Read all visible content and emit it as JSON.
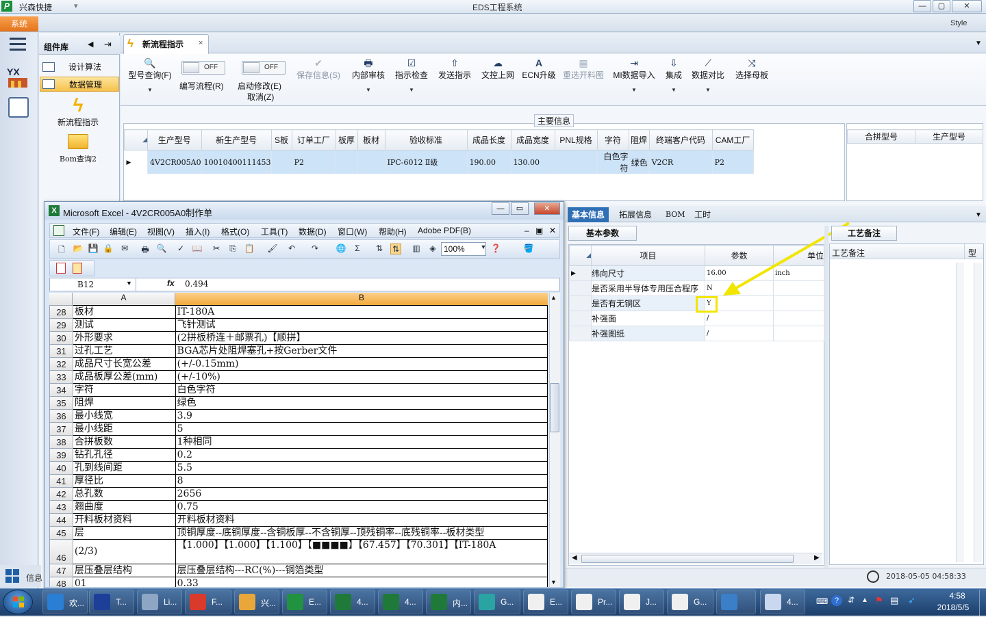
{
  "titlebar": {
    "app_name": "兴森快捷",
    "quick_access": "▾",
    "window_title": "EDS工程系统",
    "min": "—",
    "max": "▢",
    "close": "✕"
  },
  "menurow": {
    "system_label": "系统",
    "style_label": "Style"
  },
  "component_panel": {
    "title": "组件库",
    "items": [
      {
        "label": "设计算法"
      },
      {
        "label": "数据管理"
      }
    ],
    "big_buttons": [
      {
        "label": "新流程指示"
      },
      {
        "label": "Bom查询2"
      }
    ]
  },
  "tab": {
    "label": "新流程指示",
    "close": "×"
  },
  "ribbon": {
    "buttons": [
      {
        "label": "型号查询(F)",
        "icon": "search-icon",
        "glyph": "🔍"
      },
      {
        "label": "编写流程(R)",
        "toggle": "OFF"
      },
      {
        "label": "启动修改(E)",
        "sub": "取消(Z)",
        "toggle": "OFF"
      },
      {
        "label": "保存信息(S)",
        "icon": "check-icon",
        "glyph": "✔",
        "disabled": true
      },
      {
        "label": "内部审核",
        "icon": "print-icon",
        "glyph": "🖶"
      },
      {
        "label": "指示检查",
        "icon": "checkbox-icon",
        "glyph": "☑"
      },
      {
        "label": "发送指示",
        "icon": "upload-icon",
        "glyph": "⇧"
      },
      {
        "label": "文控上网",
        "icon": "cloud-upload-icon",
        "glyph": "☁"
      },
      {
        "label": "ECN升级",
        "icon": "ecn-icon",
        "glyph": "A"
      },
      {
        "label": "重选开料图",
        "icon": "image-icon",
        "glyph": "▦",
        "disabled": true
      },
      {
        "label": "MI数据导入",
        "icon": "import-icon",
        "glyph": "⇥"
      },
      {
        "label": "集成",
        "icon": "download-icon",
        "glyph": "⇩"
      },
      {
        "label": "数据对比",
        "icon": "compare-icon",
        "glyph": "⟋"
      },
      {
        "label": "选择母板",
        "icon": "shuffle-icon",
        "glyph": "⤨"
      }
    ]
  },
  "main_info": {
    "legend": "主要信息",
    "columns": [
      "生产型号",
      "新生产型号",
      "S板",
      "订单工厂",
      "板厚",
      "板材",
      "验收标准",
      "成品长度",
      "成品宽度",
      "PNL规格",
      "字符",
      "阻焊",
      "终端客户代码",
      "CAM工厂"
    ],
    "row": [
      "4V2CR005A0",
      "10010400111453",
      "",
      "P2",
      "",
      "",
      "IPC-6012 Ⅱ级",
      "190.00",
      "130.00",
      "",
      "白色字符",
      "绿色",
      "V2CR",
      "P2"
    ],
    "side_columns": [
      "合拼型号",
      "生产型号"
    ]
  },
  "lower": {
    "tabs": [
      "基本信息",
      "拓展信息",
      "BOM",
      "工时"
    ],
    "section": "基本参数",
    "columns": [
      "项目",
      "参数",
      "单位"
    ],
    "rows": [
      [
        "纬向尺寸",
        "16.00",
        "inch"
      ],
      [
        "是否采用半导体专用压合程序",
        "N",
        ""
      ],
      [
        "是否有无铜区",
        "Y",
        ""
      ],
      [
        "补强面",
        "/",
        ""
      ],
      [
        "补强图纸",
        "/",
        ""
      ]
    ],
    "remark_header": "工艺备注",
    "remark_col": "工艺备注",
    "remark_col2": "型",
    "datetime": "2018-05-05 04:58:33"
  },
  "info_label": "信息",
  "excel": {
    "title": "Microsoft Excel - 4V2CR005A0制作单",
    "menu": [
      "文件(F)",
      "编辑(E)",
      "视图(V)",
      "插入(I)",
      "格式(O)",
      "工具(T)",
      "数据(D)",
      "窗口(W)",
      "帮助(H)",
      "Adobe PDF(B)"
    ],
    "zoom": "100%",
    "namebox": "B12",
    "fx": "fx",
    "formula": "0.494",
    "col_a": "A",
    "col_b": "B",
    "rows": [
      {
        "n": "28",
        "a": "板材",
        "b": "IT-180A"
      },
      {
        "n": "29",
        "a": "测试",
        "b": "飞针测试"
      },
      {
        "n": "30",
        "a": "外形要求",
        "b": "(2拼板桥连＋邮票孔)【顺拼】"
      },
      {
        "n": "31",
        "a": "过孔工艺",
        "b": "BGA芯片处阻焊塞孔+按Gerber文件"
      },
      {
        "n": "32",
        "a": "成品尺寸长宽公差",
        "b": "(+/-0.15mm)"
      },
      {
        "n": "33",
        "a": "成品板厚公差(mm)",
        "b": "(+/-10%)"
      },
      {
        "n": "34",
        "a": "字符",
        "b": "白色字符"
      },
      {
        "n": "35",
        "a": "阻焊",
        "b": "绿色"
      },
      {
        "n": "36",
        "a": "最小线宽",
        "b": "3.9"
      },
      {
        "n": "37",
        "a": "最小线距",
        "b": "5"
      },
      {
        "n": "38",
        "a": "合拼板数",
        "b": "1种相同"
      },
      {
        "n": "39",
        "a": "钻孔孔径",
        "b": "0.2"
      },
      {
        "n": "40",
        "a": "孔到线间距",
        "b": "5.5"
      },
      {
        "n": "41",
        "a": "厚径比",
        "b": "8"
      },
      {
        "n": "42",
        "a": "总孔数",
        "b": "2656"
      },
      {
        "n": "43",
        "a": "翘曲度",
        "b": "0.75"
      },
      {
        "n": "44",
        "a": "开料板材资料",
        "b": "开料板材资料"
      },
      {
        "n": "45",
        "a": "层",
        "b": "顶铜厚度--底铜厚度--含铜板厚--不含铜厚--顶残铜率--底残铜率--板材类型"
      },
      {
        "n": "46",
        "a": "(2/3)",
        "b": "【1.000】【1.000】【1.100】【■■■■】【67.457】【70.301】【IT-180A"
      },
      {
        "n": "47",
        "a": "层压叠层结构",
        "b": "层压叠层结构---RC(%)---铜箔类型"
      },
      {
        "n": "48",
        "a": "01",
        "b": "0.33"
      }
    ]
  },
  "taskbar": {
    "items": [
      {
        "label": "欢...",
        "color": "#2a7fd4"
      },
      {
        "label": "T...",
        "color": "#1d3f99"
      },
      {
        "label": "Li...",
        "color": "#8ea6c4"
      },
      {
        "label": "F...",
        "color": "#d93a2a"
      },
      {
        "label": "兴...",
        "color": "#e9a63a"
      },
      {
        "label": "E...",
        "color": "#21923f"
      },
      {
        "label": "4...",
        "color": "#1f7a3a"
      },
      {
        "label": "4...",
        "color": "#1f7a3a"
      },
      {
        "label": "内...",
        "color": "#1f7a3a"
      },
      {
        "label": "G...",
        "color": "#2aa3a3"
      },
      {
        "label": "E...",
        "color": "#f0f0f0"
      },
      {
        "label": "Pr...",
        "color": "#f0f0f0"
      },
      {
        "label": "J...",
        "color": "#f0f0f0"
      },
      {
        "label": "G...",
        "color": "#f0f0f0"
      },
      {
        "label": "",
        "color": "#3a7fc8"
      },
      {
        "label": "4...",
        "color": "#c9d8ee"
      }
    ],
    "time": "4:58",
    "date": "2018/5/5"
  }
}
